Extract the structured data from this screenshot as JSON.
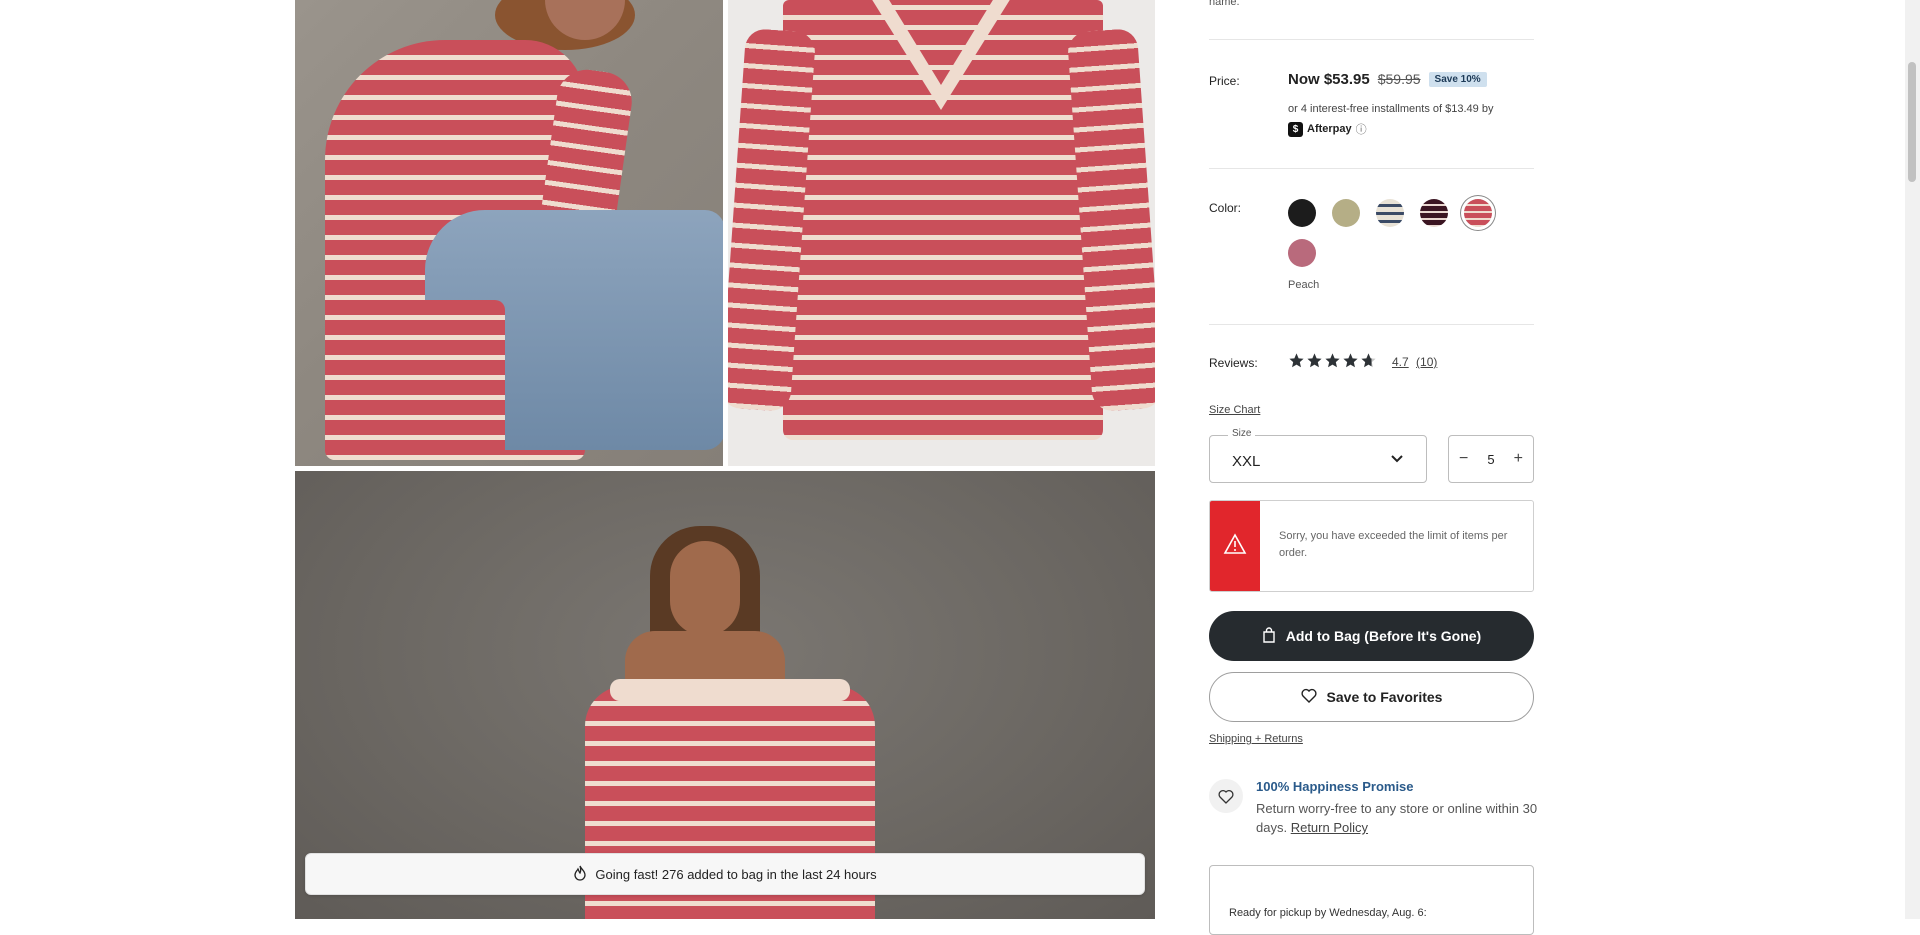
{
  "intro": {
    "tail_text": "name."
  },
  "price": {
    "label": "Price:",
    "now": "Now $53.95",
    "was": "$59.95",
    "badge": "Save 10%",
    "installments": "or 4 interest-free installments of $13.49 by",
    "afterpay": "Afterpay",
    "afterpay_info": "ⓘ"
  },
  "color": {
    "label": "Color:",
    "selected_name": "Peach",
    "swatches": [
      {
        "name": "Black",
        "hex": "#1c1c1c"
      },
      {
        "name": "Olive",
        "hex": "#b5ae86"
      },
      {
        "name": "Cream Navy Stripe",
        "hex": "#c7c3bd"
      },
      {
        "name": "Burgundy Stripe",
        "hex": "#4a1c2a"
      },
      {
        "name": "Peach",
        "hex": "#c94f5a"
      },
      {
        "name": "Mauve",
        "hex": "#b96a7c"
      }
    ]
  },
  "reviews": {
    "label": "Reviews:",
    "rating": 4.7,
    "rating_text": "4.7",
    "count_text": "(10)"
  },
  "size_chart_link": "Size Chart",
  "size": {
    "legend": "Size",
    "value": "XXL"
  },
  "quantity": {
    "minus": "−",
    "value": "5",
    "plus": "+"
  },
  "error": {
    "message": "Sorry, you have exceeded the limit of items per order."
  },
  "buttons": {
    "add_to_bag": "Add to Bag (Before It's Gone)",
    "save_favorites": "Save to Favorites"
  },
  "shipping_link": "Shipping + Returns",
  "promise": {
    "title": "100% Happiness Promise",
    "text": "Return worry-free to any store or online within 30 days.",
    "link": "Return Policy"
  },
  "pickup": {
    "text": "Ready for pickup by Wednesday, Aug. 6:"
  },
  "toast": {
    "text": "Going fast! 276 added to bag in the last 24 hours"
  },
  "colors": {
    "dark_button": "#262b2f",
    "error_red": "#e1262c",
    "link_blue": "#2a5a8a"
  }
}
